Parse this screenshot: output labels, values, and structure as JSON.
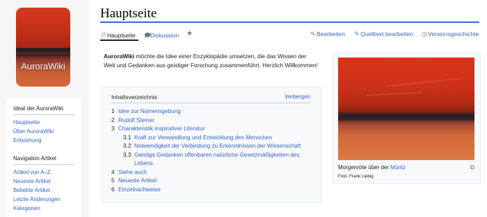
{
  "logo": {
    "text": "AuroraWiki"
  },
  "sidebar": {
    "sections": [
      {
        "heading": "Ideal der AuroraWiki",
        "items": [
          "Hauptseite",
          "Über AuroraWiki",
          "Entstehung"
        ]
      },
      {
        "heading": "Navigation Artikel",
        "items": [
          "Artikel von A–Z",
          "Neueste Artikel",
          "Beliebte Artikel",
          "Letzte Änderungen",
          "Kategorien"
        ]
      }
    ]
  },
  "page": {
    "title": "Hauptseite"
  },
  "tabs": {
    "article": "Hauptseite",
    "discussion": "Diskussion",
    "edit": "Bearbeiten",
    "edit_source": "Quelltext bearbeiten",
    "history": "Versionsgeschichte"
  },
  "intro": {
    "bold": "AuroraWiki",
    "rest": " möchte die Idee einer Enzyklopädie umsetzen, die das Wissen der Welt und Gedanken aus geistiger Forschung zusammenführt. Herzlich Willkommen!"
  },
  "toc": {
    "heading": "Inhaltsverzeichnis",
    "toggle": "Verbergen",
    "items": [
      {
        "num": "1",
        "text": "Idee zur Namensgebung",
        "level": 1
      },
      {
        "num": "2",
        "text": "Rudolf Steiner",
        "level": 1
      },
      {
        "num": "3",
        "text": "Charakteristik inspirativer Literatur",
        "level": 1
      },
      {
        "num": "3.1",
        "text": "Kraft zur Verwandlung und Entwicklung des Menschen",
        "level": 2
      },
      {
        "num": "3.2",
        "text": "Notwendigkeit der Verbindung zu Erkenntnissen der Wissenschaft",
        "level": 2
      },
      {
        "num": "3.3",
        "text": "Geistige Gedanken offenbaren natürliche Gesetzmäßigkeiten des Lebens",
        "level": 2
      },
      {
        "num": "4",
        "text": "Siehe auch",
        "level": 1
      },
      {
        "num": "5",
        "text": "Neueste Artikel",
        "level": 1
      },
      {
        "num": "6",
        "text": "Einzelnachweise",
        "level": 1
      }
    ]
  },
  "thumbnail": {
    "caption_prefix": "Morgenröte über der ",
    "caption_link": "Müritz",
    "credit": "Foto: Frank Liebig"
  },
  "icons": {
    "article": "page-icon",
    "discussion": "speech-bubble-icon",
    "watch": "star-icon",
    "edit": "pencil-icon",
    "edit_source": "source-pencil-icon",
    "history": "clock-icon",
    "magnify": "enlarge-icon"
  },
  "colors": {
    "link": "#3366cc",
    "accent_rule": "#3366cc"
  }
}
